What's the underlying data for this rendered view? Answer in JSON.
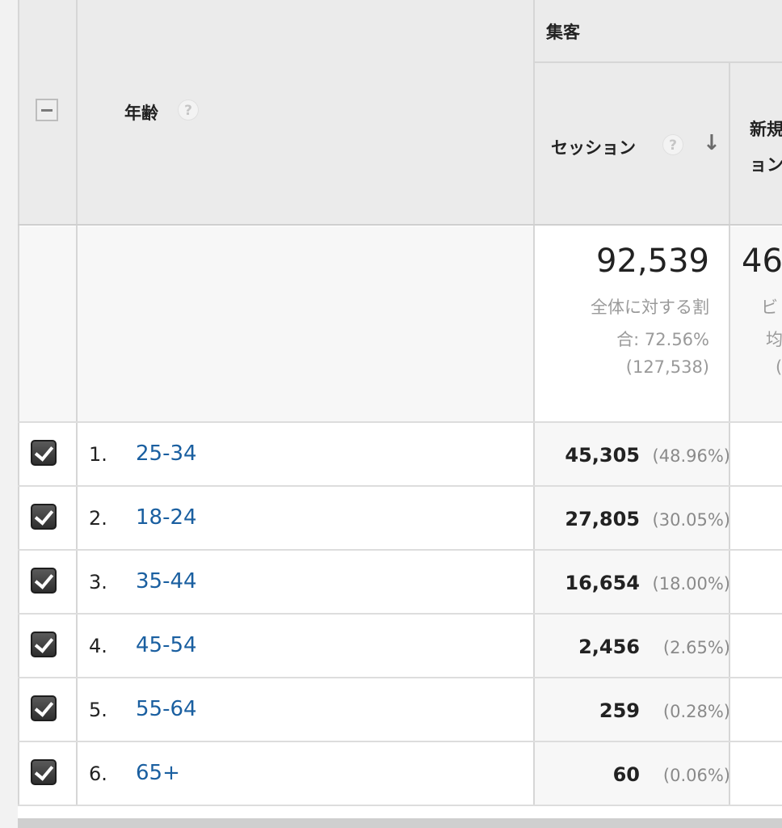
{
  "header": {
    "group_label": "集客",
    "dimension_label": "年齢",
    "help_glyph": "?",
    "sessions_label": "セッション",
    "sort_icon": "arrow-down-icon",
    "next_col_label_line1": "新規",
    "next_col_label_line2": "ョン"
  },
  "summary": {
    "total": "92,539",
    "pct_line1": "全体に対する割",
    "pct_line2": "合: 72.56%",
    "pct_line3": "(127,538)",
    "next_total": "46",
    "next_line1": "ビ",
    "next_line2": "均",
    "next_line3": "("
  },
  "rows": [
    {
      "rank": "1.",
      "age": "25-34",
      "sessions": "45,305",
      "pct": "(48.96%)",
      "checked": true
    },
    {
      "rank": "2.",
      "age": "18-24",
      "sessions": "27,805",
      "pct": "(30.05%)",
      "checked": true
    },
    {
      "rank": "3.",
      "age": "35-44",
      "sessions": "16,654",
      "pct": "(18.00%)",
      "checked": true
    },
    {
      "rank": "4.",
      "age": "45-54",
      "sessions": "2,456",
      "pct": "(2.65%)",
      "checked": true
    },
    {
      "rank": "5.",
      "age": "55-64",
      "sessions": "259",
      "pct": "(0.28%)",
      "checked": true
    },
    {
      "rank": "6.",
      "age": "65+",
      "sessions": "60",
      "pct": "(0.06%)",
      "checked": true
    }
  ],
  "colors": {
    "link": "#1a5fa0",
    "checkbox": "#3a3a3a",
    "header_bg": "#ebebeb"
  }
}
